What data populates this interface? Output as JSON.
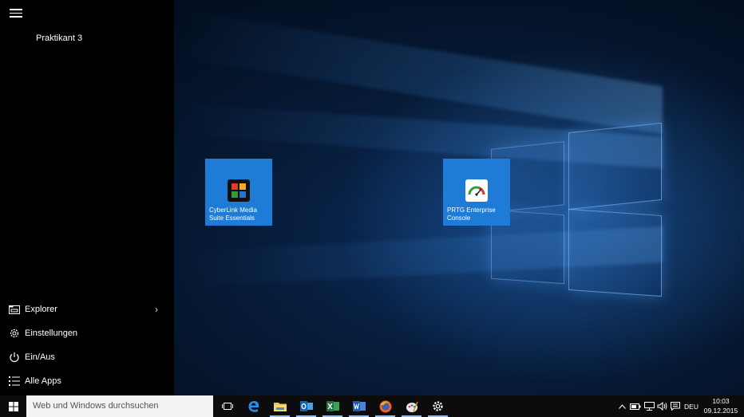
{
  "start_menu": {
    "user_name": "Praktikant 3",
    "items": [
      {
        "label": "Explorer",
        "icon": "file-explorer-icon",
        "has_submenu": true
      },
      {
        "label": "Einstellungen",
        "icon": "gear-icon"
      },
      {
        "label": "Ein/Aus",
        "icon": "power-icon"
      },
      {
        "label": "Alle Apps",
        "icon": "list-icon"
      }
    ]
  },
  "tiles": [
    {
      "label": "CyberLink Media Suite Essentials",
      "icon": "cyberlink-icon"
    },
    {
      "label": "PRTG Enterprise Console",
      "icon": "prtg-gauge-icon"
    }
  ],
  "taskbar": {
    "search_placeholder": "Web und Windows durchsuchen",
    "apps": [
      "task-view-icon",
      "edge-icon",
      "file-explorer-icon",
      "outlook-icon",
      "excel-icon",
      "word-icon",
      "firefox-icon",
      "paint-icon",
      "settings-gear-icon"
    ],
    "tray": {
      "language": "DEU",
      "time": "10:03",
      "date": "09.12.2015"
    }
  },
  "colors": {
    "tile": "#1e7bd6",
    "taskbar": "#0c0c0c",
    "start_menu": "#000000",
    "search_box": "#f3f3f3"
  }
}
